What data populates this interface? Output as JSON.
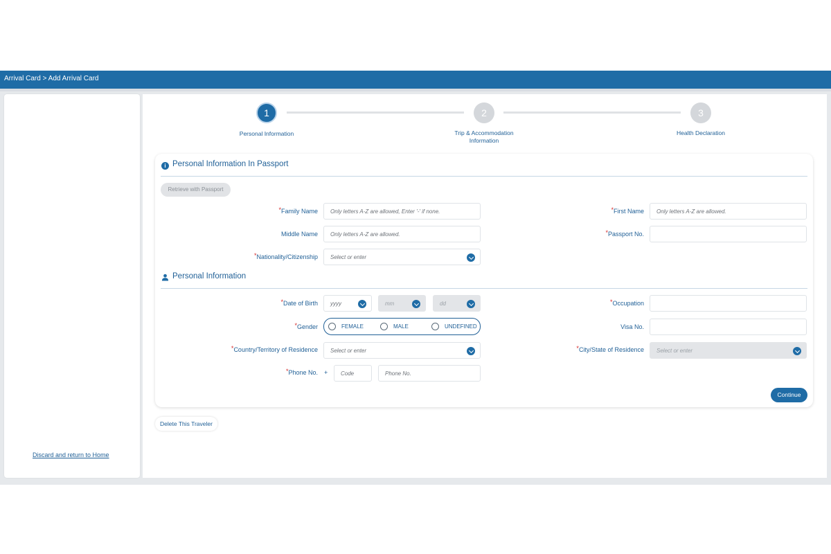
{
  "breadcrumb": {
    "root": "Arrival Card",
    "separator": ">",
    "current": "Add Arrival Card"
  },
  "sidebar": {
    "discard_link": "Discard and return to Home"
  },
  "stepper": {
    "steps": [
      {
        "number": "1",
        "label": "Personal Information",
        "state": "active"
      },
      {
        "number": "2",
        "label_line1": "Trip & Accommodation",
        "label_line2": "Information",
        "state": "inactive"
      },
      {
        "number": "3",
        "label": "Health Declaration",
        "state": "inactive"
      }
    ]
  },
  "passport_section": {
    "title": "Personal Information In Passport",
    "icon": "info-icon",
    "retrieve_button": "Retrieve with Passport",
    "family_name": {
      "label": "Family Name",
      "required": true,
      "placeholder": "Only letters A-Z are allowed, Enter '-' if none."
    },
    "first_name": {
      "label": "First Name",
      "required": true,
      "placeholder": "Only letters A-Z are allowed."
    },
    "middle_name": {
      "label": "Middle Name",
      "required": false,
      "placeholder": "Only letters A-Z are allowed."
    },
    "passport_no": {
      "label": "Passport No.",
      "required": true,
      "placeholder": ""
    },
    "nationality": {
      "label": "Nationality/Citizenship",
      "required": true,
      "placeholder": "Select or enter"
    }
  },
  "personal_section": {
    "title": "Personal Information",
    "icon": "person-icon",
    "dob": {
      "label": "Date of Birth",
      "required": true,
      "year": "yyyy",
      "month": "mm",
      "day": "dd"
    },
    "occupation": {
      "label": "Occupation",
      "required": true,
      "placeholder": ""
    },
    "gender": {
      "label": "Gender",
      "required": true,
      "options": [
        "FEMALE",
        "MALE",
        "UNDEFINED"
      ]
    },
    "visa_no": {
      "label": "Visa No.",
      "required": false,
      "placeholder": ""
    },
    "country_residence": {
      "label": "Country/Territory of Residence",
      "required": true,
      "placeholder": "Select or enter"
    },
    "city_residence": {
      "label": "City/State of Residence",
      "required": true,
      "placeholder": "Select or enter"
    },
    "phone": {
      "label": "Phone No.",
      "required": true,
      "plus": "+",
      "code_placeholder": "Code",
      "number_placeholder": "Phone No."
    }
  },
  "actions": {
    "continue": "Continue",
    "delete_traveler": "Delete This Traveler"
  },
  "colors": {
    "primary": "#1f6ca6",
    "required": "#d62b2b",
    "disabled": "#e3e5e8"
  }
}
